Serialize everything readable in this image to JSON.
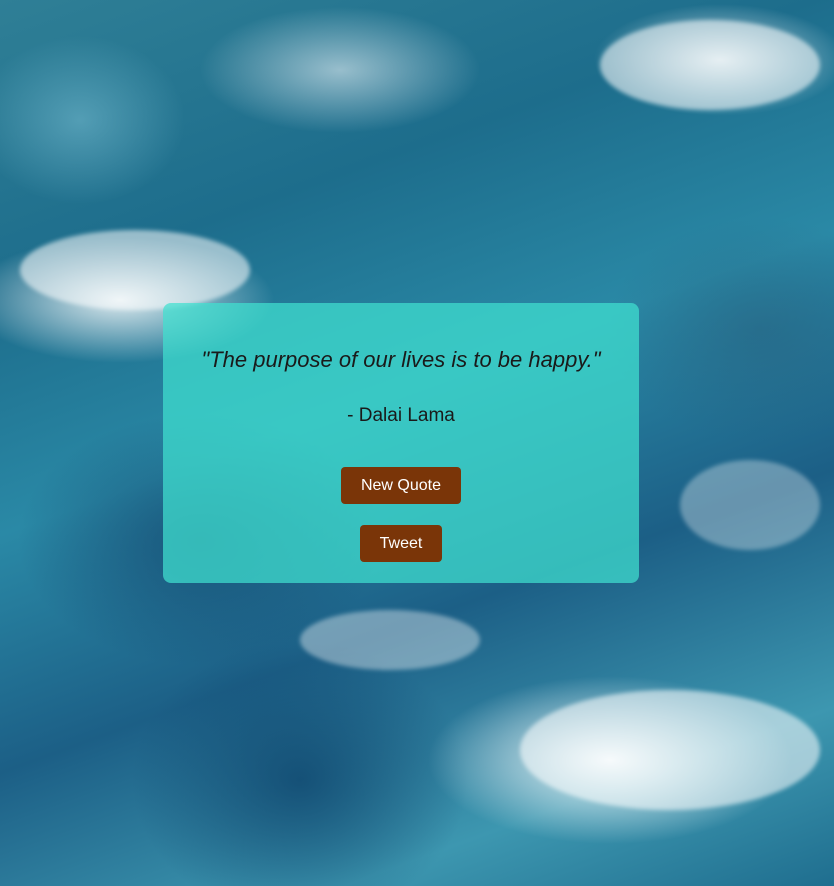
{
  "quote": {
    "text": "\"The purpose of our lives is to be happy.\"",
    "author": "- Dalai Lama"
  },
  "buttons": {
    "new_quote_label": "New Quote",
    "tweet_label": "Tweet"
  },
  "colors": {
    "card_background": "#40e0d0",
    "button_background": "#7a3508",
    "button_text": "#ffffff"
  },
  "background": {
    "image": "ocean-waves-aerial"
  }
}
